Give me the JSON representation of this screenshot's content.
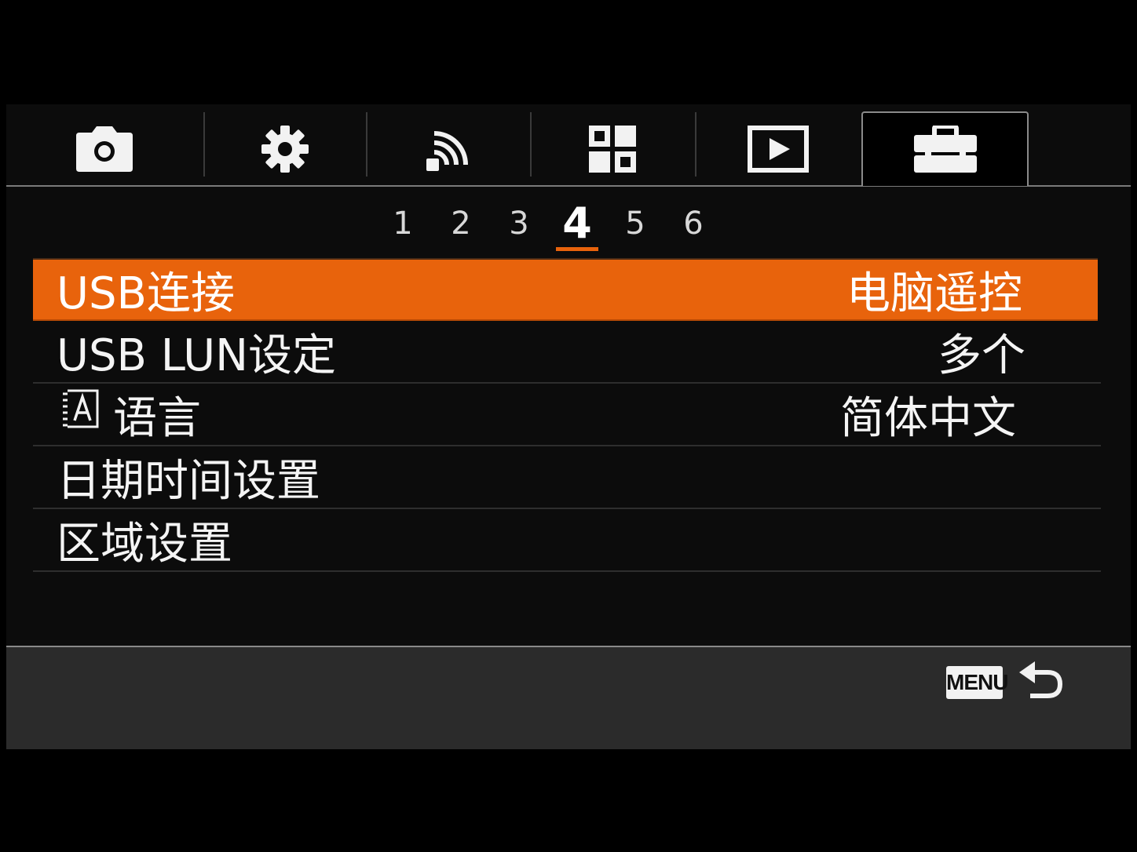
{
  "tabs": [
    {
      "icon": "camera-icon",
      "active": false
    },
    {
      "icon": "gear-icon",
      "active": false
    },
    {
      "icon": "wireless-icon",
      "active": false
    },
    {
      "icon": "custom-grid-icon",
      "active": false
    },
    {
      "icon": "playback-icon",
      "active": false
    },
    {
      "icon": "toolbox-icon",
      "active": true
    }
  ],
  "pager": {
    "pages": [
      "1",
      "2",
      "3",
      "4",
      "5",
      "6"
    ],
    "current": "4"
  },
  "menu": {
    "items": [
      {
        "label": "USB连接",
        "value": "电脑遥控",
        "selected": true
      },
      {
        "label": "USB LUN设定",
        "value": "多个",
        "selected": false
      },
      {
        "label": "语言",
        "value": "简体中文",
        "selected": false,
        "icon": "language-icon"
      },
      {
        "label": "日期时间设置",
        "value": "",
        "selected": false
      },
      {
        "label": "区域设置",
        "value": "",
        "selected": false
      }
    ]
  },
  "footer": {
    "menu_key_label": "MENU",
    "back_icon": "return-arrow-icon"
  },
  "colors": {
    "accent": "#e8630c",
    "background": "#0c0c0c",
    "footer_bg": "#2b2b2b"
  }
}
